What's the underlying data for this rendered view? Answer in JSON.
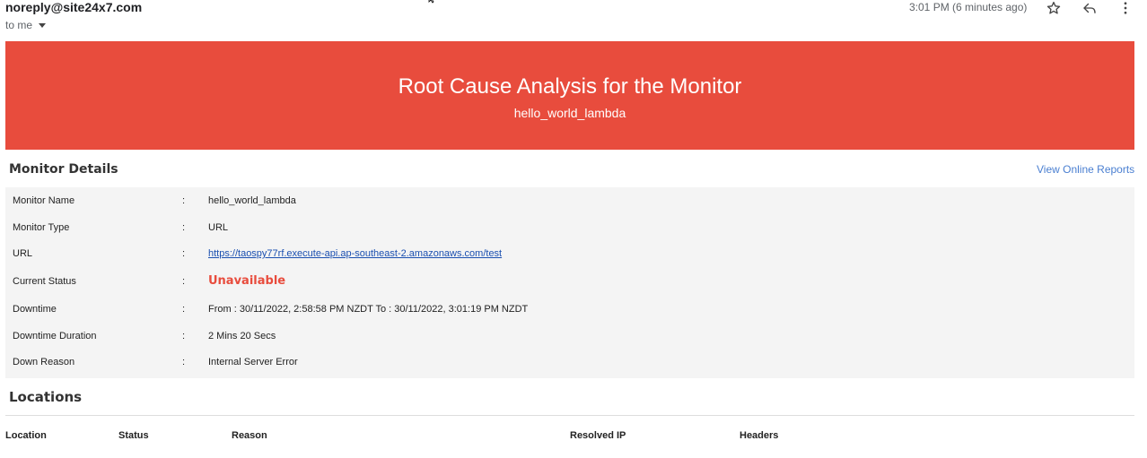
{
  "email": {
    "sender": "noreply@site24x7.com",
    "recipient": "to me",
    "timestamp": "3:01 PM (6 minutes ago)",
    "icons": [
      "star-icon",
      "reply-icon",
      "more-vert-icon"
    ]
  },
  "banner": {
    "title": "Root Cause Analysis for the Monitor",
    "subtitle": "hello_world_lambda",
    "color": "#e84c3d"
  },
  "monitor_details": {
    "heading": "Monitor Details",
    "link": "View Online Reports",
    "separator": ":",
    "rows": [
      {
        "label": "Monitor Name",
        "value": "hello_world_lambda"
      },
      {
        "label": "Monitor Type",
        "value": "URL"
      },
      {
        "label": "URL",
        "value": "https://taospy77rf.execute-api.ap-southeast-2.amazonaws.com/test"
      },
      {
        "label": "Current Status",
        "value": "Unavailable"
      },
      {
        "label": "Downtime",
        "value": "From : 30/11/2022, 2:58:58 PM NZDT To : 30/11/2022, 3:01:19 PM NZDT"
      },
      {
        "label": "Downtime Duration",
        "value": "2 Mins 20 Secs"
      },
      {
        "label": "Down Reason",
        "value": "Internal Server Error"
      }
    ]
  },
  "locations": {
    "heading": "Locations",
    "columns": [
      "Location",
      "Status",
      "Reason",
      "Resolved IP",
      "Headers"
    ]
  }
}
